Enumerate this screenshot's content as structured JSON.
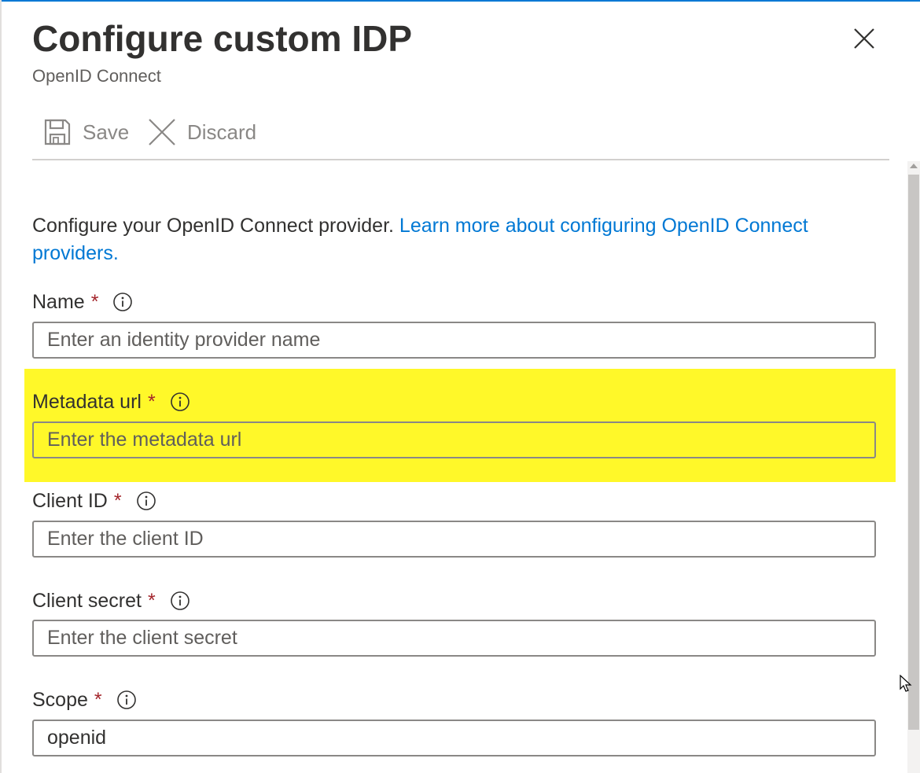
{
  "header": {
    "title": "Configure custom IDP",
    "subtitle": "OpenID Connect"
  },
  "toolbar": {
    "save_label": "Save",
    "discard_label": "Discard"
  },
  "description": {
    "text": "Configure your OpenID Connect provider. ",
    "link_text": "Learn more about configuring OpenID Connect providers."
  },
  "fields": [
    {
      "label": "Name",
      "required": "*",
      "placeholder": "Enter an identity provider name",
      "value": ""
    },
    {
      "label": "Metadata url",
      "required": "*",
      "placeholder": "Enter the metadata url",
      "value": ""
    },
    {
      "label": "Client ID",
      "required": "*",
      "placeholder": "Enter the client ID",
      "value": ""
    },
    {
      "label": "Client secret",
      "required": "*",
      "placeholder": "Enter the client secret",
      "value": ""
    },
    {
      "label": "Scope",
      "required": "*",
      "placeholder": "",
      "value": "openid"
    }
  ],
  "colors": {
    "accent": "#0078d4",
    "highlight": "#fff829",
    "required": "#a4262c"
  },
  "icons": {
    "close": "close-icon",
    "save": "save-icon",
    "discard": "discard-icon",
    "info": "info-icon"
  }
}
